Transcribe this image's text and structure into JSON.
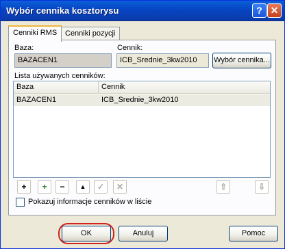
{
  "window": {
    "title": "Wybór cennika kosztorysu",
    "help_label": "?",
    "close_label": "✕"
  },
  "tabs": [
    {
      "label": "Cenniki RMS"
    },
    {
      "label": "Cenniki pozycji"
    }
  ],
  "form": {
    "baza_label": "Baza:",
    "baza_value": "BAZACEN1",
    "cennik_label": "Cennik:",
    "cennik_value": "ICB_Srednie_3kw2010",
    "wybor_button": "Wybór cennika..."
  },
  "list": {
    "label": "Lista używanych cenników:",
    "columns": [
      "Baza",
      "Cennik"
    ],
    "rows": [
      {
        "baza": "BAZACEN1",
        "cennik": "ICB_Srednie_3kw2010"
      }
    ]
  },
  "toolbar": {
    "add": "+",
    "add_from": "+",
    "remove": "−",
    "up": "▲",
    "confirm": "✓",
    "cancel": "✕",
    "move_up": "⇧",
    "move_down": "⇩"
  },
  "checkbox": {
    "label": "Pokazuj informacje cenników w liście",
    "checked": false
  },
  "buttons": {
    "ok": "OK",
    "cancel": "Anuluj",
    "help": "Pomoc"
  },
  "colors": {
    "title_bar": "#0845c4",
    "highlight_ring": "#d2231e"
  }
}
